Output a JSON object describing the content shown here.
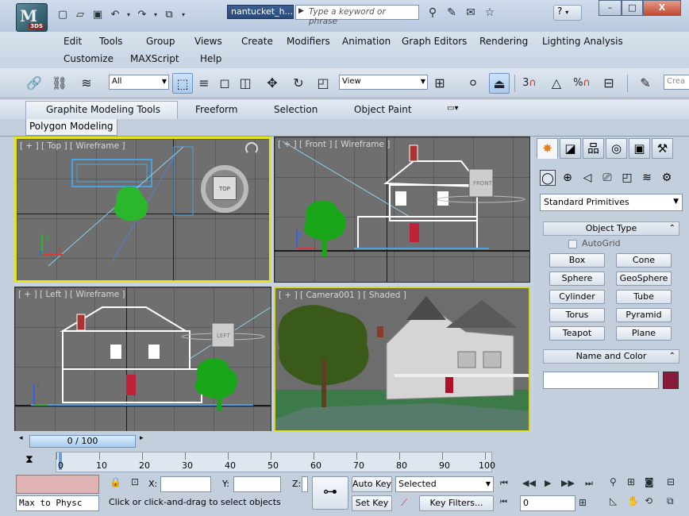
{
  "titlebar": {
    "document_name": "nantucket_h...",
    "search_placeholder": "Type a keyword or phrase",
    "help_label": "?",
    "app_badge": "3DS",
    "minimize": "–",
    "maximize": "□",
    "close": "X"
  },
  "menu": {
    "edit": "Edit",
    "tools": "Tools",
    "group": "Group",
    "views": "Views",
    "create": "Create",
    "modifiers": "Modifiers",
    "animation": "Animation",
    "graph_editors": "Graph Editors",
    "rendering": "Rendering",
    "lighting_analysis": "Lighting Analysis",
    "customize": "Customize",
    "maxscript": "MAXScript",
    "help": "Help"
  },
  "toolbar": {
    "selection_filter": "All",
    "reference_coord": "View",
    "snap_3": "3",
    "snap_percent": "%",
    "named_selection": "Crea"
  },
  "ribbon": {
    "tabs": [
      "Graphite Modeling Tools",
      "Freeform",
      "Selection",
      "Object Paint"
    ],
    "panel": "Polygon Modeling"
  },
  "viewports": {
    "top": "[ + ] [ Top ] [ Wireframe ]",
    "front": "[ + ] [ Front ] [ Wireframe ]",
    "left": "[ + ] [ Left ] [ Wireframe ]",
    "camera": "[ + ] [ Camera001 ] [ Shaded ]",
    "viewcube_top": "TOP",
    "viewcube_front": "FRONT",
    "viewcube_left": "LEFT"
  },
  "command_panel": {
    "category": "Standard Primitives",
    "object_type_header": "Object Type",
    "autogrid": "AutoGrid",
    "buttons": [
      "Box",
      "Cone",
      "Sphere",
      "GeoSphere",
      "Cylinder",
      "Tube",
      "Torus",
      "Pyramid",
      "Teapot",
      "Plane"
    ],
    "name_color_header": "Name and Color",
    "object_color": "#8a1a3a"
  },
  "timeline": {
    "frame_display": "0 / 100",
    "ticks": [
      "0",
      "10",
      "20",
      "30",
      "40",
      "50",
      "60",
      "70",
      "80",
      "90",
      "100"
    ]
  },
  "status": {
    "maxscript_listener": "Max to Physc",
    "prompt": "Click or click-and-drag to select objects",
    "x_label": "X:",
    "y_label": "Y:",
    "z_label": "Z:",
    "auto_key": "Auto Key",
    "set_key": "Set Key",
    "key_mode": "Selected",
    "key_filters": "Key Filters...",
    "current_frame": "0"
  }
}
